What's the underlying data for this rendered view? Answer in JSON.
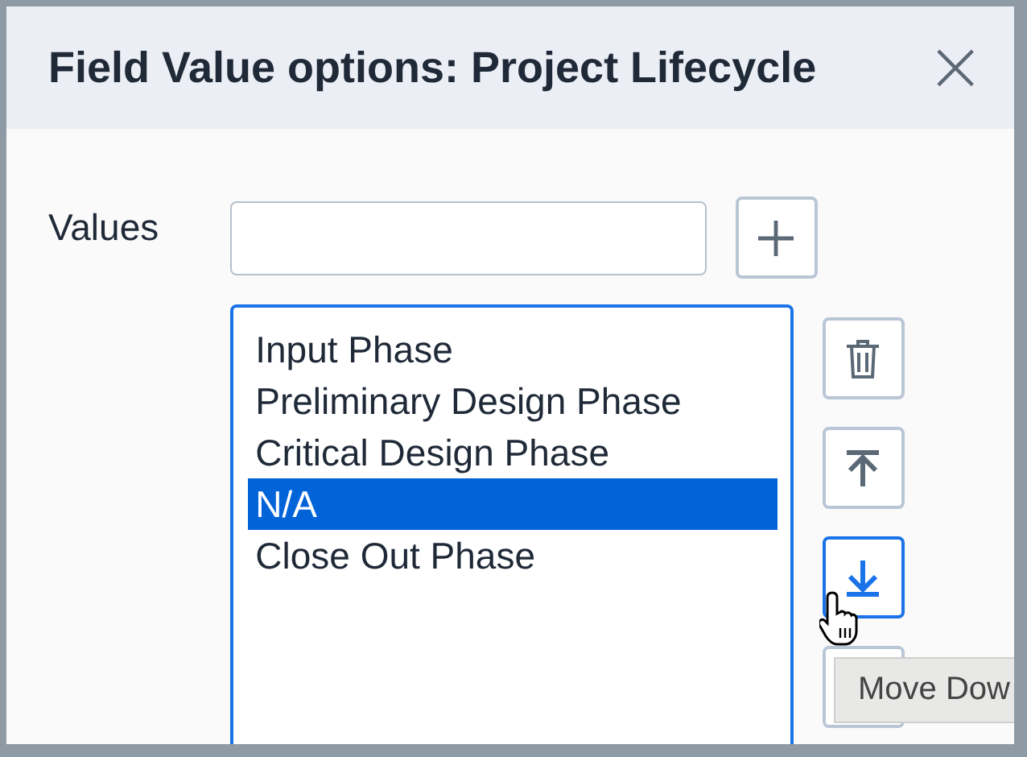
{
  "dialog": {
    "title": "Field Value options: Project Lifecycle",
    "close_icon": "×"
  },
  "values_label": "Values",
  "list": [
    {
      "label": "Input Phase",
      "selected": false
    },
    {
      "label": "Preliminary Design Phase",
      "selected": false
    },
    {
      "label": "Critical Design Phase",
      "selected": false
    },
    {
      "label": "N/A",
      "selected": true
    },
    {
      "label": "Close Out Phase",
      "selected": false
    }
  ],
  "tools": [
    {
      "kind": "delete",
      "focused": false
    },
    {
      "kind": "move-top",
      "focused": false
    },
    {
      "kind": "move-bottom",
      "focused": true
    },
    {
      "kind": "blank",
      "focused": false
    }
  ],
  "tooltip": "Move Dow"
}
